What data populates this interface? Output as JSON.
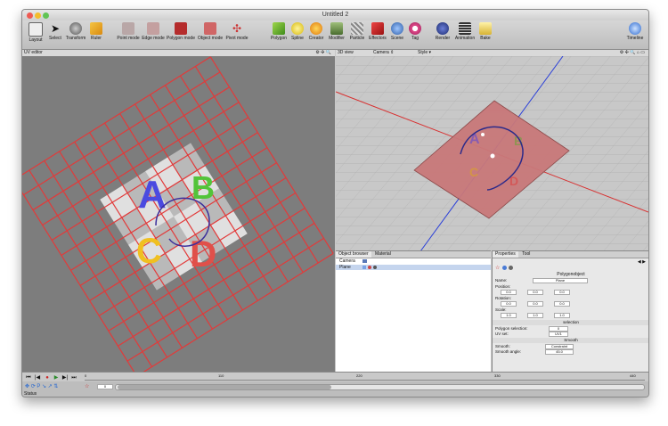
{
  "window": {
    "title": "Untitled 2"
  },
  "toolbar": {
    "tools": [
      "Layout",
      "Select",
      "Transform",
      "Ruler",
      "Point mode",
      "Edge mode",
      "Polygon mode",
      "Object mode",
      "Pivot mode",
      "Polygon",
      "Spline",
      "Creator",
      "Modifier",
      "Particle",
      "Effectors",
      "Scene",
      "Tag",
      "Render",
      "Animation",
      "Bake",
      "Timeline"
    ]
  },
  "uv_editor": {
    "title": "UV editor",
    "letters": [
      "A",
      "B",
      "C",
      "D"
    ]
  },
  "view3d": {
    "title": "3D view",
    "camera": "Camera",
    "style": "Style"
  },
  "object_browser": {
    "tabs": [
      "Object browser",
      "Material"
    ],
    "items": [
      "Camera",
      "Plane"
    ]
  },
  "properties": {
    "tabs": [
      "Properties",
      "Tool"
    ],
    "header": "Polygonobject",
    "name_label": "Name:",
    "name_value": "Plane",
    "position_label": "Position:",
    "position_values": [
      "0.0",
      "0.0",
      "0.0"
    ],
    "rotation_label": "Rotation:",
    "rotation_values": [
      "0.0",
      "0.0",
      "0.0"
    ],
    "scale_label": "Scale:",
    "scale_values": [
      "1.0",
      "1.0",
      "1.0"
    ],
    "selection_header": "selection",
    "polygon_selection_label": "Polygon selection:",
    "polygon_selection_value": "0",
    "uv_set_label": "UV set:",
    "uv_set_value": "UV1",
    "smooth_header": "Smooth",
    "smooth_label": "Smooth:",
    "smooth_value": "Constraint",
    "smooth_angle_label": "Smooth angle:",
    "smooth_angle_value": "45.0"
  },
  "timeline": {
    "ticks": [
      "0",
      "110",
      "220",
      "330",
      "440"
    ],
    "frame_value": "0",
    "status": "Status"
  },
  "colors": {
    "grid": "#e23a3a",
    "axis_x": "#d83030",
    "axis_y": "#2a3fd8"
  }
}
